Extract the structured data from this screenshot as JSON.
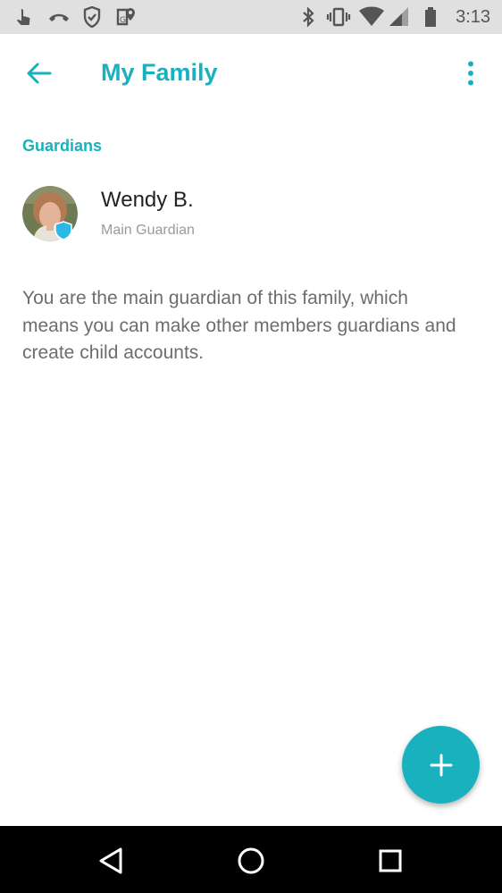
{
  "status_bar": {
    "time": "3:13",
    "left_icons": [
      "touch-icon",
      "call-icon",
      "shield-check-icon",
      "map-pin-icon"
    ],
    "right_icons": [
      "bluetooth-icon",
      "vibrate-icon",
      "wifi-icon",
      "signal-icon",
      "battery-icon"
    ]
  },
  "app_bar": {
    "title": "My Family",
    "back_icon": "arrow-left-icon",
    "more_icon": "more-vert-icon"
  },
  "guardians": {
    "section_label": "Guardians",
    "members": [
      {
        "name": "Wendy B.",
        "role": "Main Guardian"
      }
    ]
  },
  "description": "You are the main guardian of this family, which means you can make other members guardians and create child accounts.",
  "fab": {
    "icon": "plus-icon"
  },
  "nav_bar": {
    "icons": [
      "back-triangle-icon",
      "home-circle-icon",
      "recents-square-icon"
    ]
  },
  "colors": {
    "accent": "#1ab1bf",
    "badge": "#2bb7e8",
    "status_bar_bg": "#e0e0e0",
    "nav_bar_bg": "#000000"
  }
}
